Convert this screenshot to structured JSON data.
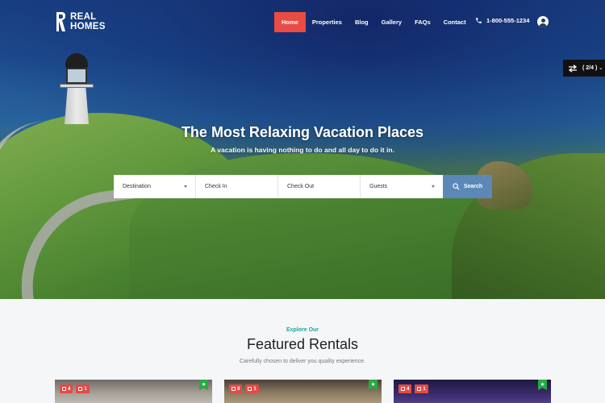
{
  "header": {
    "logo_line1": "REAL",
    "logo_line2": "HOMES",
    "nav": [
      "Home",
      "Properties",
      "Blog",
      "Gallery",
      "FAQs",
      "Contact"
    ],
    "active_nav": "Home",
    "phone": "1-800-555-1234"
  },
  "switcher": {
    "label": "( 2/4 )"
  },
  "hero": {
    "title": "The Most Relaxing Vacation Places",
    "subtitle": "A vacation is having nothing to do and all day to do it in."
  },
  "search": {
    "destination": "Destination",
    "check_in": "Check In",
    "check_out": "Check Out",
    "guests": "Guests",
    "button": "Search"
  },
  "featured": {
    "eyebrow": "Explore Our",
    "title": "Featured Rentals",
    "subtitle": "Carefully chosen to deliver you quality experience."
  },
  "cards": [
    {
      "bedrooms": "4",
      "bathrooms": "1"
    },
    {
      "bedrooms": "8",
      "bathrooms": "1"
    },
    {
      "bedrooms": "4",
      "bathrooms": "1"
    }
  ],
  "colors": {
    "accent_red": "#ea4b43",
    "search_button": "#5c88b8",
    "eyebrow_teal": "#1ea69a",
    "ribbon_green": "#27a944"
  }
}
